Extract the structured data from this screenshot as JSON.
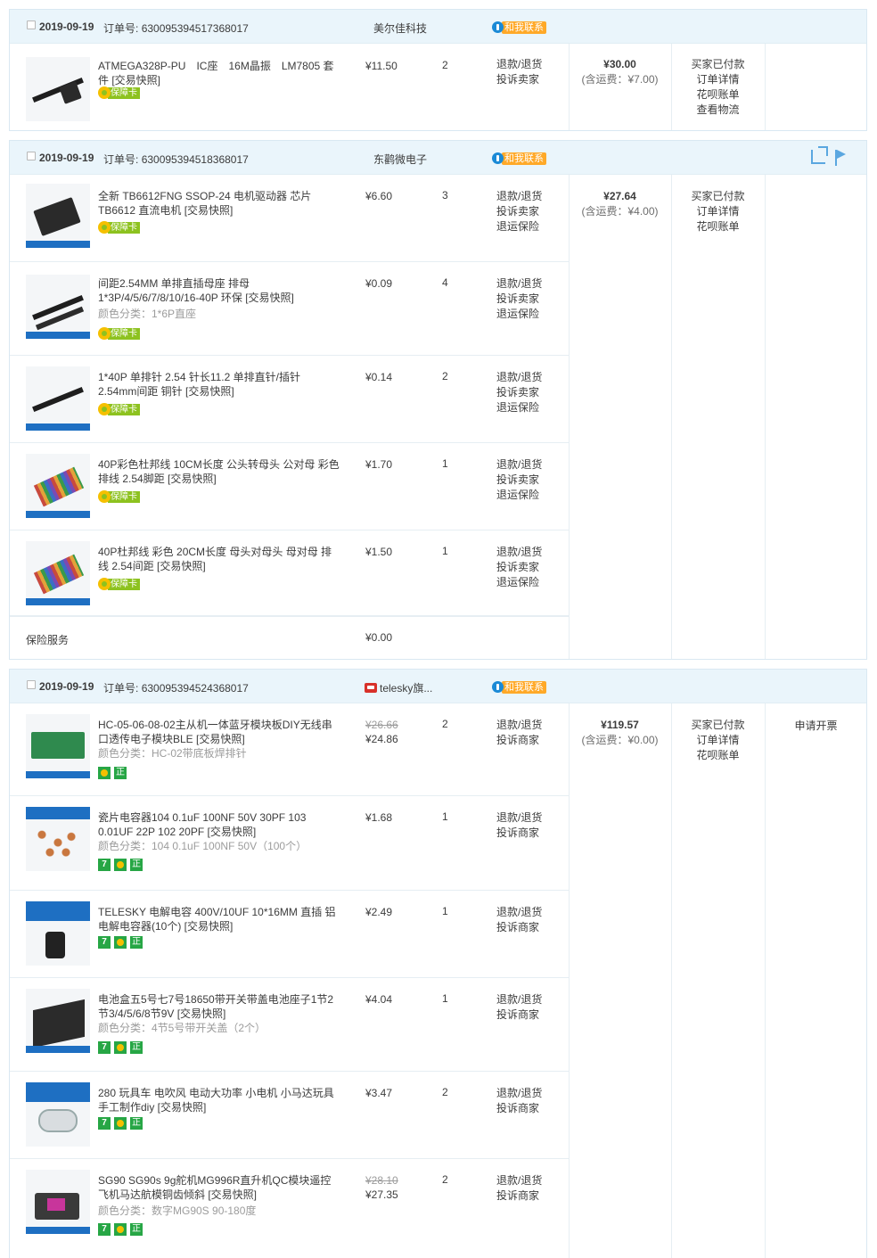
{
  "common": {
    "order_label": "订单号:",
    "contact_label": "和我联系",
    "guarantee_label": "保障卡",
    "badge_7": "7",
    "badge_zheng": "正",
    "ops_refund": "退款/退货",
    "ops_complain_seller": "投诉卖家",
    "ops_complain_merchant": "投诉商家",
    "ops_return_insurance": "退运保险"
  },
  "orders": [
    {
      "date": "2019-09-19",
      "order_no": "630095394517368017",
      "shop": "美尔佳科技",
      "total": "¥30.00",
      "shipping": "(含运费：¥7.00)",
      "status": [
        "买家已付款",
        "订单详情",
        "花呗账单",
        "查看物流"
      ],
      "extra": "",
      "items": [
        {
          "title": "ATMEGA328P-PU　IC座　16M晶振　LM7805 套件 [交易快照]",
          "price": "¥11.50",
          "qty": "2",
          "ops": [
            "退款/退货",
            "投诉卖家"
          ]
        }
      ]
    },
    {
      "date": "2019-09-19",
      "order_no": "630095394518368017",
      "shop": "东鹳微电子",
      "total": "¥27.64",
      "shipping": "(含运费：¥4.00)",
      "status": [
        "买家已付款",
        "订单详情",
        "花呗账单"
      ],
      "extra": "",
      "insurance_label": "保险服务",
      "insurance_value": "¥0.00",
      "items": [
        {
          "title": "全新 TB6612FNG SSOP-24 电机驱动器 芯片TB6612 直流电机 [交易快照]",
          "price": "¥6.60",
          "qty": "3",
          "ops": [
            "退款/退货",
            "投诉卖家",
            "退运保险"
          ]
        },
        {
          "title": "间距2.54MM 单排直插母座 排母 1*3P/4/5/6/7/8/10/16-40P 环保 [交易快照]",
          "sku": "颜色分类：1*6P直座",
          "price": "¥0.09",
          "qty": "4",
          "ops": [
            "退款/退货",
            "投诉卖家",
            "退运保险"
          ]
        },
        {
          "title": "1*40P 单排针 2.54 针长11.2 单排直针/插针 2.54mm间距 铜针 [交易快照]",
          "price": "¥0.14",
          "qty": "2",
          "ops": [
            "退款/退货",
            "投诉卖家",
            "退运保险"
          ]
        },
        {
          "title": "40P彩色杜邦线 10CM长度 公头转母头 公对母 彩色排线 2.54脚距 [交易快照]",
          "price": "¥1.70",
          "qty": "1",
          "ops": [
            "退款/退货",
            "投诉卖家",
            "退运保险"
          ]
        },
        {
          "title": "40P杜邦线 彩色 20CM长度 母头对母头 母对母 排线 2.54间距 [交易快照]",
          "price": "¥1.50",
          "qty": "1",
          "ops": [
            "退款/退货",
            "投诉卖家",
            "退运保险"
          ]
        }
      ]
    },
    {
      "date": "2019-09-19",
      "order_no": "630095394524368017",
      "shop": "telesky旗...",
      "total": "¥119.57",
      "shipping": "(含运费：¥0.00)",
      "status": [
        "买家已付款",
        "订单详情",
        "花呗账单"
      ],
      "extra": "申请开票",
      "items": [
        {
          "title": "HC-05-06-08-02主从机一体蓝牙模块板DIY无线串口透传电子模块BLE [交易快照]",
          "sku": "颜色分类：HC-02带底板焊排针",
          "old_price": "¥26.66",
          "price": "¥24.86",
          "qty": "2",
          "ops": [
            "退款/退货",
            "投诉商家"
          ]
        },
        {
          "title": "瓷片电容器104 0.1uF 100NF 50V 30PF 103 0.01UF 22P 102 20PF [交易快照]",
          "sku": "颜色分类：104 0.1uF 100NF 50V（100个）",
          "price": "¥1.68",
          "qty": "1",
          "ops": [
            "退款/退货",
            "投诉商家"
          ]
        },
        {
          "title": "TELESKY 电解电容 400V/10UF 10*16MM 直插 铝电解电容器(10个) [交易快照]",
          "price": "¥2.49",
          "qty": "1",
          "ops": [
            "退款/退货",
            "投诉商家"
          ]
        },
        {
          "title": "电池盒五5号七7号18650带开关带盖电池座子1节2节3/4/5/6/8节9V [交易快照]",
          "sku": "颜色分类：4节5号带开关盖（2个）",
          "price": "¥4.04",
          "qty": "1",
          "ops": [
            "退款/退货",
            "投诉商家"
          ]
        },
        {
          "title": "280 玩具车 电吹风 电动大功率 小电机 小马达玩具 手工制作diy [交易快照]",
          "price": "¥3.47",
          "qty": "2",
          "ops": [
            "退款/退货",
            "投诉商家"
          ]
        },
        {
          "title": "SG90 SG90s 9g舵机MG996R直升机QC模块遥控飞机马达航模铜齿倾斜 [交易快照]",
          "sku": "颜色分类：数字MG90S 90-180度",
          "old_price": "¥28.10",
          "price": "¥27.35",
          "qty": "2",
          "ops": [
            "退款/退货",
            "投诉商家"
          ]
        }
      ]
    }
  ]
}
